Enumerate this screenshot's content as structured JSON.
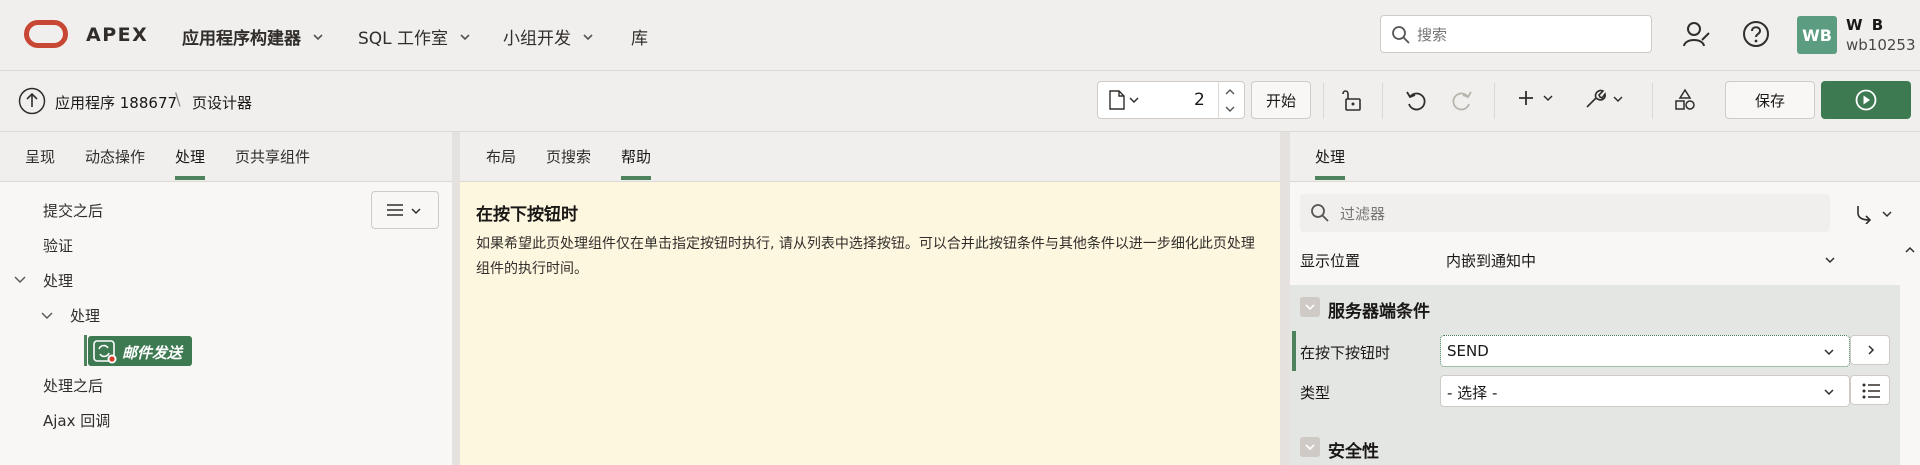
{
  "header": {
    "brand": "APEX",
    "nav": [
      {
        "label": "应用程序构建器"
      },
      {
        "label": "SQL 工作室"
      },
      {
        "label": "小组开发"
      },
      {
        "label": "库"
      }
    ],
    "search_placeholder": "搜索",
    "avatar_initials": "WB",
    "user_display": "W B",
    "user_id": "wb10253"
  },
  "toolbar": {
    "breadcrumb_app": "应用程序 188677",
    "breadcrumb_sep": "\\",
    "breadcrumb_page": "页设计器",
    "page_number": "2",
    "go_label": "开始",
    "save_label": "保存"
  },
  "left_panel": {
    "tabs": [
      "呈现",
      "动态操作",
      "处理",
      "页共享组件"
    ],
    "active_tab": "处理",
    "tree": {
      "after_submit": "提交之后",
      "validation": "验证",
      "processing": "处理",
      "processing_child": "处理",
      "mail_process": "邮件发送",
      "after_processing": "处理之后",
      "ajax_callback": "Ajax 回调"
    }
  },
  "center_panel": {
    "tabs": [
      "布局",
      "页搜索",
      "帮助"
    ],
    "active_tab": "帮助",
    "help_title": "在按下按钮时",
    "help_text": "如果希望此页处理组件仅在单击指定按钮时执行, 请从列表中选择按钮。可以合并此按钮条件与其他条件以进一步细化此页处理组件的执行时间。"
  },
  "right_panel": {
    "tab": "处理",
    "filter_placeholder": "过滤器",
    "display_position_label": "显示位置",
    "display_position_value": "内嵌到通知中",
    "server_condition_header": "服务器端条件",
    "when_button_pressed_label": "在按下按钮时",
    "when_button_pressed_value": "SEND",
    "type_label": "类型",
    "type_value": "- 选择 -",
    "security_header": "安全性"
  },
  "colors": {
    "accent_green": "#4c825c",
    "run_button": "#3d7a52",
    "oracle_red": "#c74634",
    "help_bg": "#fef7e0",
    "avatar_bg": "#5c9d81"
  }
}
